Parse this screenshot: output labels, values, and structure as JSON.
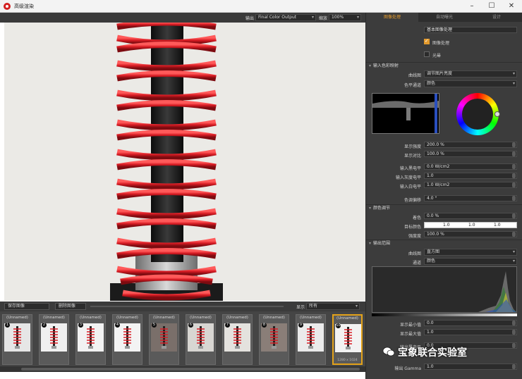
{
  "window": {
    "title": "高级渲染"
  },
  "viewport_toolbar": {
    "output_label": "输出",
    "output_value": "Final Color Output",
    "zoom_label": "缩放",
    "zoom_value": "100%"
  },
  "panel": {
    "tabs": [
      "图像处理",
      "自动曝光",
      "设计"
    ],
    "header_field": "基本图像处理",
    "enable_label": "图像处理",
    "enable_checked": true,
    "lut_label": "光晕",
    "lut_checked": false,
    "tone_section": "输入色彩映射",
    "camera_label": "曲线图",
    "camera_value": "调节图片亮度",
    "mapping_label": "色平通道",
    "mapping_value": "颜色",
    "display_strength_label": "显示强度",
    "display_strength_value": "200.0 %",
    "display_contrast_label": "显示对比",
    "display_contrast_value": "100.0 %",
    "input_black_label": "输入黑电平",
    "input_black_value": "0.0 W/cm2",
    "input_gamma_label": "输入灰度电平",
    "input_gamma_value": "1.0",
    "input_white_label": "输入白电平",
    "input_white_value": "1.0 W/cm2",
    "hue_label": "色调偏移",
    "hue_value": "4.0 °",
    "color_section": "颜色调节",
    "saturation_label": "着色",
    "saturation_value": "0.0 %",
    "target_color_label": "目标颜色",
    "target_color_values": [
      "1.0",
      "1.0",
      "1.0"
    ],
    "strength_label": "强度度",
    "strength_value": "100.0 %",
    "output_section": "输出范围",
    "curve_label": "曲线图",
    "curve_value": "直方图",
    "channel_label": "通道",
    "channel_value": "颜色",
    "display_min_label": "显示最小值",
    "display_min_value": "0.0",
    "display_max_label": "显示最大值",
    "display_max_value": "1.0",
    "out_black_label": "输出黑电平",
    "out_black_value": "0.0",
    "out_gamma_label": "输出 Gamma",
    "out_gamma_value": "1.0"
  },
  "snapshots": {
    "save_button": "保存图像",
    "delete_button": "删除图像",
    "sort_label": "显示",
    "sort_value": "所有",
    "items": [
      {
        "name": "(Unnamed)",
        "badge": "1"
      },
      {
        "name": "(Unnamed)",
        "badge": "2"
      },
      {
        "name": "(Unnamed)",
        "badge": "3"
      },
      {
        "name": "(Unnamed)",
        "badge": "4"
      },
      {
        "name": "(Unnamed)",
        "badge": "5"
      },
      {
        "name": "(Unnamed)",
        "badge": "6"
      },
      {
        "name": "(Unnamed)",
        "badge": "7"
      },
      {
        "name": "(Unnamed)",
        "badge": "8"
      },
      {
        "name": "(Unnamed)",
        "badge": "9"
      },
      {
        "name": "(Unnamed)",
        "badge": "10",
        "res": "1280 x 1024"
      }
    ]
  },
  "watermark": "宝象联合实验室",
  "colors": {
    "accent": "#e39a2d",
    "spring": "#d81c24",
    "panel": "#3c3c3c"
  }
}
